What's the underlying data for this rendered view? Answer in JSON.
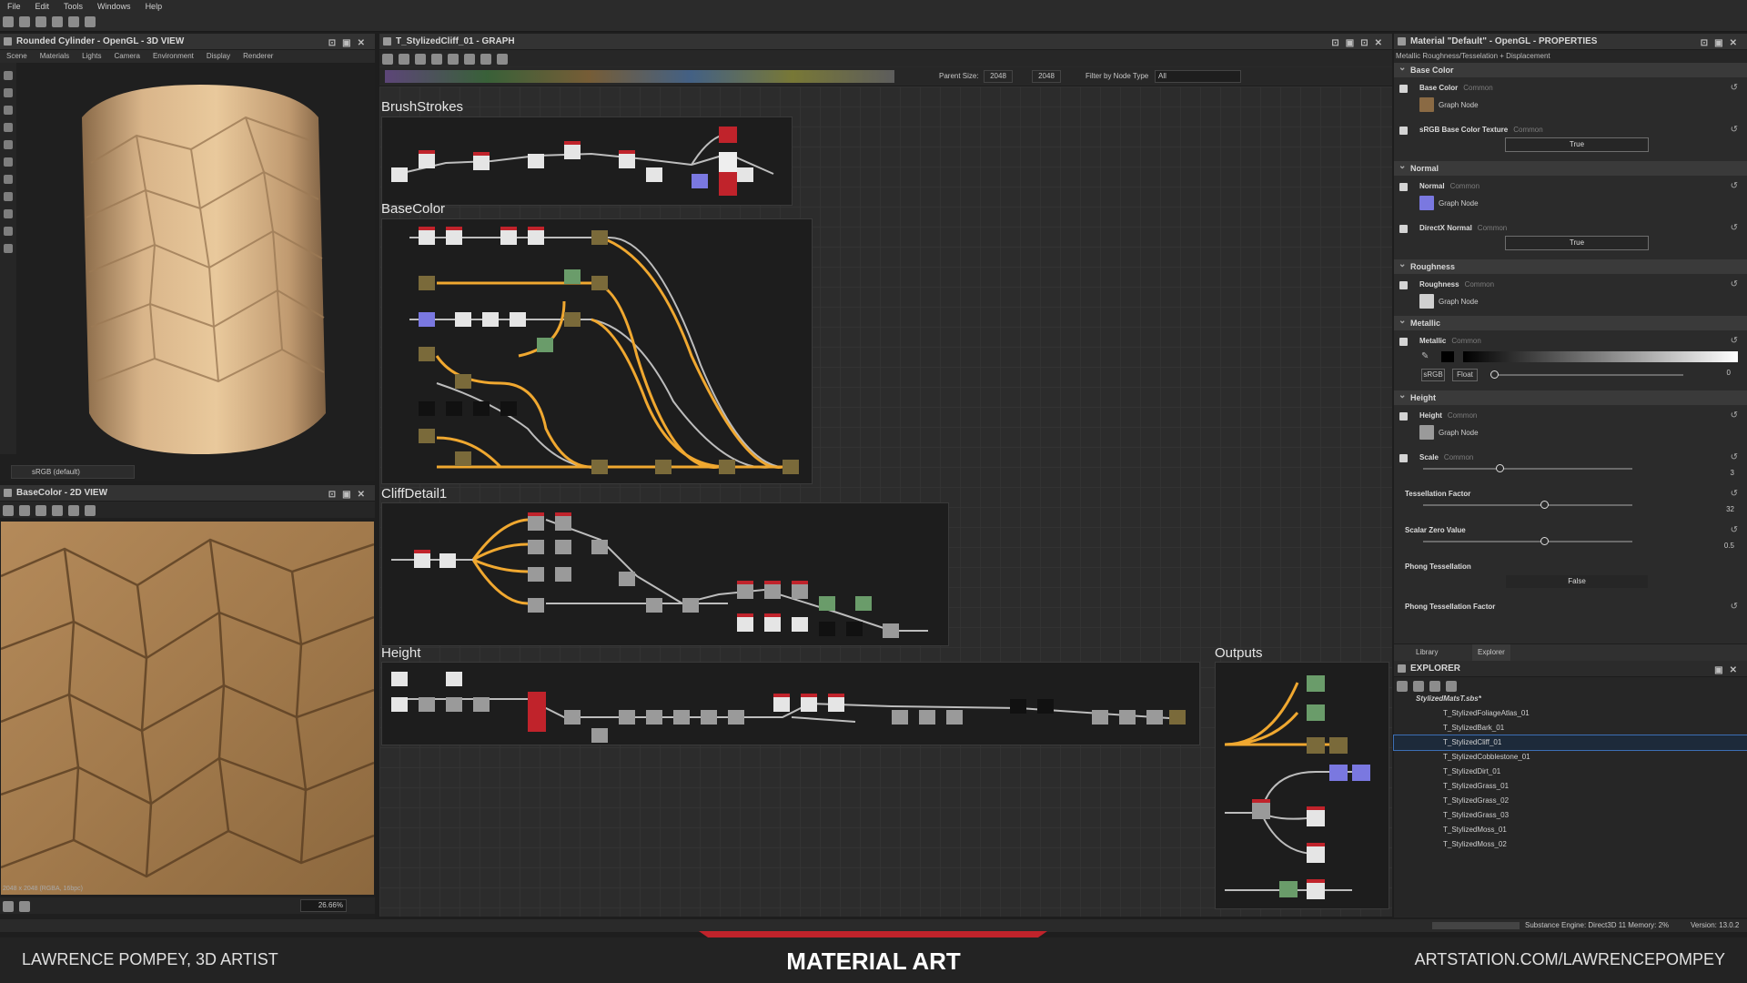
{
  "menu": [
    "File",
    "Edit",
    "Tools",
    "Windows",
    "Help"
  ],
  "viewport3d": {
    "title": "Rounded Cylinder - OpenGL - 3D VIEW",
    "tabs": [
      "Scene",
      "Materials",
      "Lights",
      "Camera",
      "Environment",
      "Display",
      "Renderer"
    ],
    "colorspace": "sRGB (default)"
  },
  "viewport2d": {
    "title": "BaseColor - 2D VIEW",
    "resolution_info": "2048 x 2048 (RGBA, 16bpc)",
    "zoom": "26.66%"
  },
  "graph": {
    "title": "T_StylizedCliff_01 - GRAPH",
    "parent_size_label": "Parent Size:",
    "parent_size": "2048",
    "size_value": "2048",
    "filter_label": "Filter by Node Type",
    "filter_value": "All",
    "frames": [
      "BrushStrokes",
      "BaseColor",
      "CliffDetail1",
      "Height",
      "Outputs"
    ]
  },
  "properties": {
    "title": "Material \"Default\" - OpenGL - PROPERTIES",
    "subtitle": "Metallic Roughness/Tesselation + Displacement",
    "common": "Common",
    "graph_node": "Graph Node",
    "sections": {
      "base_color": "Base Color",
      "normal": "Normal",
      "roughness": "Roughness",
      "metallic": "Metallic",
      "height": "Height"
    },
    "rows": {
      "base_color": "Base Color",
      "srgb_texture": "sRGB Base Color Texture",
      "srgb_texture_value": "True",
      "normal": "Normal",
      "directx_normal": "DirectX Normal",
      "directx_value": "True",
      "roughness": "Roughness",
      "metallic": "Metallic",
      "metallic_srgb": "sRGB",
      "metallic_float": "Float",
      "metallic_value": "0",
      "height": "Height",
      "scale": "Scale",
      "scale_value": "3",
      "tess_factor": "Tessellation Factor",
      "tess_factor_value": "32",
      "scalar_zero": "Scalar Zero Value",
      "scalar_zero_value": "0.5",
      "phong": "Phong Tessellation",
      "phong_value": "False",
      "phong_factor": "Phong Tessellation Factor"
    }
  },
  "explorer": {
    "tabs": [
      "Library",
      "Explorer"
    ],
    "title": "EXPLORER",
    "package": "StylizedMatsT.sbs*",
    "items": [
      "T_StylizedFoliageAtlas_01",
      "T_StylizedBark_01",
      "T_StylizedCliff_01",
      "T_StylizedCobblestone_01",
      "T_StylizedDirt_01",
      "T_StylizedGrass_01",
      "T_StylizedGrass_02",
      "T_StylizedGrass_03",
      "T_StylizedMoss_01",
      "T_StylizedMoss_02"
    ],
    "selected": "T_StylizedCliff_01"
  },
  "status": {
    "engine": "Substance Engine: Direct3D 11  Memory: 2%",
    "version": "Version: 13.0.2"
  },
  "footer": {
    "left": "LAWRENCE POMPEY, 3D ARTIST",
    "center": "MATERIAL ART",
    "right": "ARTSTATION.COM/LAWRENCEPOMPEY"
  },
  "colors": {
    "accent_red": "#c0232b",
    "wire_orange": "#f0a830",
    "selection_blue": "#3c6fb4"
  }
}
